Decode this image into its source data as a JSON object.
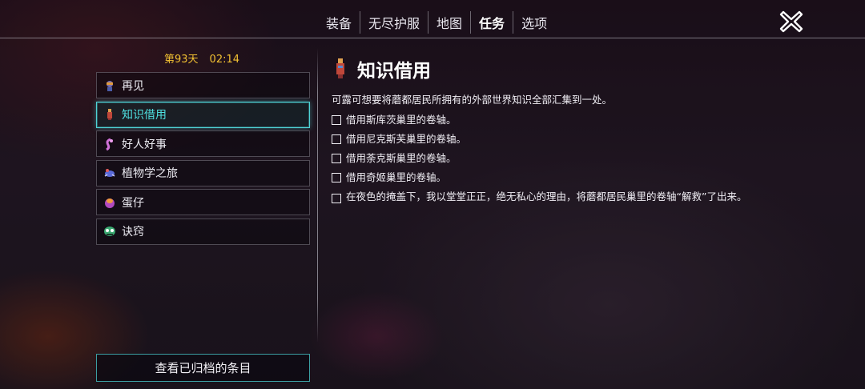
{
  "nav": {
    "tabs": [
      "装备",
      "无尽护服",
      "地图",
      "任务",
      "选项"
    ],
    "active_tab": "任务"
  },
  "close_icon": "close-x-icon",
  "status": {
    "day": "第93天",
    "time": "02:14"
  },
  "quests": [
    {
      "label": "再见",
      "icon": "character-portrait-icon",
      "selected": false
    },
    {
      "label": "知识借用",
      "icon": "scroll-holder-icon",
      "selected": true
    },
    {
      "label": "好人好事",
      "icon": "tentacle-creature-icon",
      "selected": false
    },
    {
      "label": "植物学之旅",
      "icon": "beetle-icon",
      "selected": false
    },
    {
      "label": "蛋仔",
      "icon": "egg-icon",
      "selected": false
    },
    {
      "label": "诀窍",
      "icon": "green-creature-icon",
      "selected": false
    }
  ],
  "archive_button": "查看已归档的条目",
  "detail": {
    "title": "知识借用",
    "description": "可露可想要将蘑都居民所拥有的外部世界知识全部汇集到一处。",
    "objectives": [
      "借用斯库茨巢里的卷轴。",
      "借用尼克斯芙巢里的卷轴。",
      "借用荼克斯巢里的卷轴。",
      "借用奇姬巢里的卷轴。",
      "在夜色的掩盖下，我以堂堂正正，绝无私心的理由，将蘑都居民巢里的卷轴“解救”了出来。"
    ]
  },
  "colors": {
    "accent_cyan": "#4fd3d6",
    "day_gold": "#f2c132"
  }
}
